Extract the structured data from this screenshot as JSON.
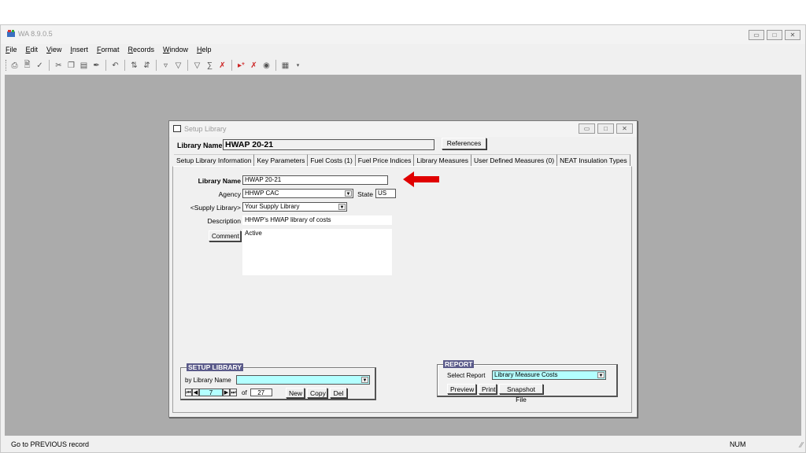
{
  "window": {
    "title": "WA 8.9.0.5"
  },
  "menu": [
    "File",
    "Edit",
    "View",
    "Insert",
    "Format",
    "Records",
    "Window",
    "Help"
  ],
  "toolbar_icons": [
    "print-icon",
    "print-preview-icon",
    "spelling-icon",
    "cut-icon",
    "copy-icon",
    "paste-icon",
    "format-painter-icon",
    "undo-icon",
    "sort-ascending-icon",
    "sort-descending-icon",
    "filter-by-selection-icon",
    "filter-by-form-icon",
    "apply-filter-icon",
    "remove-filter-icon",
    "clear-filter-icon",
    "new-record-icon",
    "delete-record-icon",
    "find-icon",
    "database-window-icon"
  ],
  "status": {
    "text": "Go to PREVIOUS record",
    "num": "NUM"
  },
  "child": {
    "title": "Setup Library",
    "library_name_label": "Library Name",
    "library_name_value": "HWAP 20-21",
    "references_label": "References",
    "tabs": [
      "Setup Library Information",
      "Key Parameters",
      "Fuel Costs (1)",
      "Fuel Price Indices",
      "Library Measures",
      "User Defined Measures (0)",
      "NEAT Insulation Types"
    ],
    "form": {
      "library_name_label": "Library Name",
      "library_name_value": "HWAP 20-21",
      "agency_label": "Agency",
      "agency_value": "HHWP CAC",
      "state_label": "State",
      "state_value": "US",
      "supply_label": "<Supply Library>",
      "supply_value": "Your Supply Library",
      "description_label": "Description",
      "description_value": "HHWP's HWAP library of costs",
      "comment_label": "Comment",
      "comment_value": "Active"
    },
    "setup_group": {
      "title": "SETUP LIBRARY",
      "by_label": "by Library  Name",
      "record_current": "7",
      "of_label": "of",
      "record_total": "27",
      "new_label": "New",
      "copy_label": "Copy",
      "del_label": "Del"
    },
    "report_group": {
      "title": "REPORT",
      "select_label": "Select Report",
      "select_value": "Library Measure Costs",
      "preview_label": "Preview",
      "print_label": "Print",
      "snapshot_label": "Snapshot File"
    }
  },
  "colors": {
    "workspace": "#ababab",
    "arrow": "#e00000",
    "highlight_field": "#b3ffff",
    "group_title": "#5a5a8a"
  }
}
